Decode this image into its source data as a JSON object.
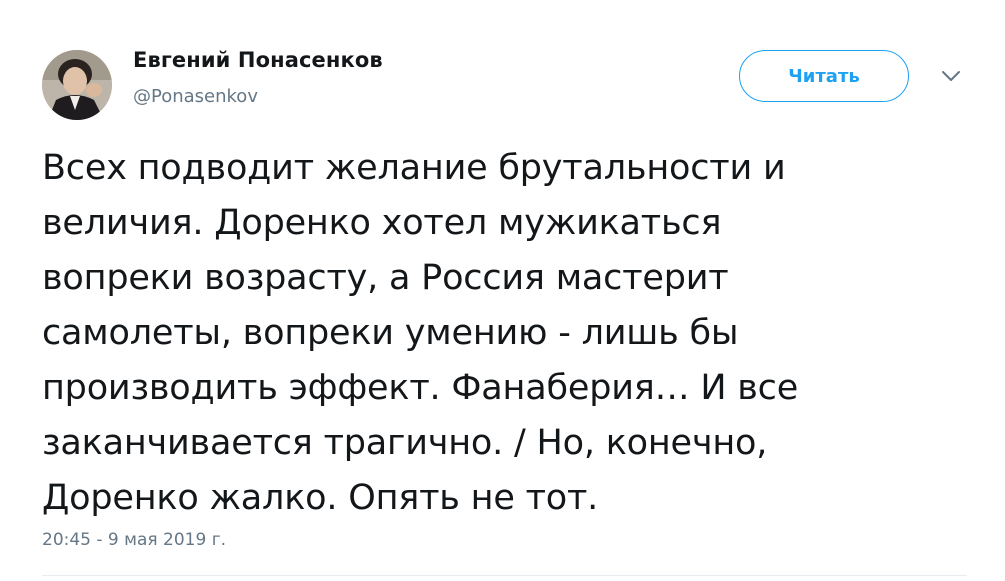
{
  "author": {
    "name": "Евгений Понасенков",
    "handle": "@Ponasenkov"
  },
  "follow_button": {
    "label": "Читать"
  },
  "tweet": {
    "text": "Всех подводит желание брутальности и\nвеличия. Доренко хотел мужикаться\nвопреки возрасту, а Россия мастерит\nсамолеты, вопреки умению - лишь бы\nпроизводить эффект. Фанаберия… И все\nзаканчивается трагично. / Но, конечно,\nДоренко жалко. Опять не тот.",
    "timestamp": "20:45 - 9 мая 2019 г."
  },
  "icons": {
    "more": "chevron-down-icon"
  },
  "colors": {
    "accent": "#1da1f2",
    "secondary_text": "#657786",
    "primary_text": "#14171a",
    "divider": "#e6ecf0"
  }
}
